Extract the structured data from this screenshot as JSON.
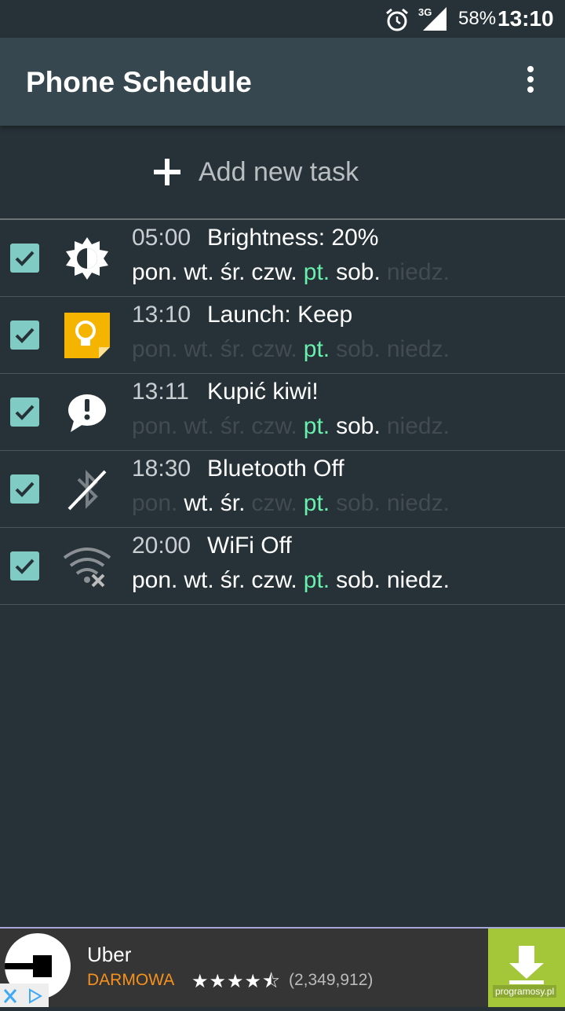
{
  "status_bar": {
    "network": "3G",
    "battery": "58%",
    "time": "13:10"
  },
  "app_bar": {
    "title": "Phone Schedule"
  },
  "add_task": {
    "label": "Add new task"
  },
  "tasks": [
    {
      "time": "05:00",
      "name": "Brightness: 20%",
      "icon": "brightness-icon",
      "checked": true,
      "days": [
        {
          "label": "pon.",
          "state": "on"
        },
        {
          "label": "wt.",
          "state": "on"
        },
        {
          "label": "śr.",
          "state": "on"
        },
        {
          "label": "czw.",
          "state": "on"
        },
        {
          "label": "pt.",
          "state": "today"
        },
        {
          "label": "sob.",
          "state": "on"
        },
        {
          "label": "niedz.",
          "state": "off"
        }
      ]
    },
    {
      "time": "13:10",
      "name": "Launch: Keep",
      "icon": "keep-app-icon",
      "checked": true,
      "days": [
        {
          "label": "pon.",
          "state": "off"
        },
        {
          "label": "wt.",
          "state": "off"
        },
        {
          "label": "śr.",
          "state": "off"
        },
        {
          "label": "czw.",
          "state": "off"
        },
        {
          "label": "pt.",
          "state": "today"
        },
        {
          "label": "sob.",
          "state": "off"
        },
        {
          "label": "niedz.",
          "state": "off"
        }
      ]
    },
    {
      "time": "13:11",
      "name": "Kupić kiwi!",
      "icon": "notification-icon",
      "checked": true,
      "days": [
        {
          "label": "pon.",
          "state": "off"
        },
        {
          "label": "wt.",
          "state": "off"
        },
        {
          "label": "śr.",
          "state": "off"
        },
        {
          "label": "czw.",
          "state": "off"
        },
        {
          "label": "pt.",
          "state": "today"
        },
        {
          "label": "sob.",
          "state": "on"
        },
        {
          "label": "niedz.",
          "state": "off"
        }
      ]
    },
    {
      "time": "18:30",
      "name": "Bluetooth Off",
      "icon": "bluetooth-off-icon",
      "checked": true,
      "days": [
        {
          "label": "pon.",
          "state": "off"
        },
        {
          "label": "wt.",
          "state": "on"
        },
        {
          "label": "śr.",
          "state": "on"
        },
        {
          "label": "czw.",
          "state": "off"
        },
        {
          "label": "pt.",
          "state": "today"
        },
        {
          "label": "sob.",
          "state": "off"
        },
        {
          "label": "niedz.",
          "state": "off"
        }
      ]
    },
    {
      "time": "20:00",
      "name": "WiFi Off",
      "icon": "wifi-off-icon",
      "checked": true,
      "days": [
        {
          "label": "pon.",
          "state": "on"
        },
        {
          "label": "wt.",
          "state": "on"
        },
        {
          "label": "śr.",
          "state": "on"
        },
        {
          "label": "czw.",
          "state": "on"
        },
        {
          "label": "pt.",
          "state": "today"
        },
        {
          "label": "sob.",
          "state": "on"
        },
        {
          "label": "niedz.",
          "state": "on"
        }
      ]
    }
  ],
  "ad": {
    "app_name": "Uber",
    "price": "DARMOWA",
    "rating": 4.5,
    "stars": "★★★★⯪",
    "reviews": "(2,349,912)",
    "watermark": "programosy.pl"
  }
}
